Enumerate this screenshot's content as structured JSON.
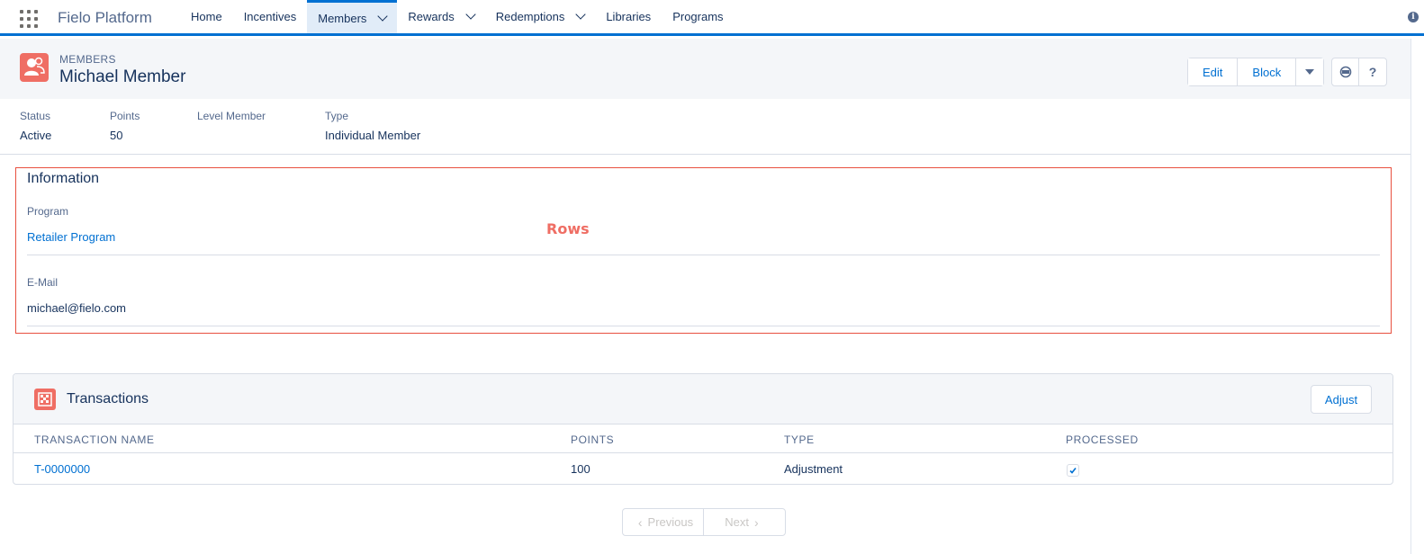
{
  "app": {
    "name": "Fielo Platform"
  },
  "nav": {
    "items": [
      {
        "label": "Home",
        "has_menu": false,
        "active": false
      },
      {
        "label": "Incentives",
        "has_menu": false,
        "active": false
      },
      {
        "label": "Members",
        "has_menu": true,
        "active": true
      },
      {
        "label": "Rewards",
        "has_menu": true,
        "active": false
      },
      {
        "label": "Redemptions",
        "has_menu": true,
        "active": false
      },
      {
        "label": "Libraries",
        "has_menu": false,
        "active": false
      },
      {
        "label": "Programs",
        "has_menu": false,
        "active": false
      }
    ]
  },
  "record": {
    "object_label": "MEMBERS",
    "title": "Michael Member",
    "actions": {
      "edit": "Edit",
      "block": "Block"
    }
  },
  "highlights": [
    {
      "label": "Status",
      "value": "Active"
    },
    {
      "label": "Points",
      "value": "50"
    },
    {
      "label": "Level Member",
      "value": ""
    },
    {
      "label": "Type",
      "value": "Individual Member"
    }
  ],
  "information": {
    "title": "Information",
    "annotation": "Rows",
    "fields": [
      {
        "label": "Program",
        "value": "Retailer Program",
        "is_link": true
      },
      {
        "label": "E-Mail",
        "value": "michael@fielo.com",
        "is_link": false
      }
    ]
  },
  "transactions": {
    "title": "Transactions",
    "adjust_label": "Adjust",
    "columns": [
      "TRANSACTION NAME",
      "POINTS",
      "TYPE",
      "PROCESSED"
    ],
    "rows": [
      {
        "name": "T-0000000",
        "points": "100",
        "type": "Adjustment",
        "processed": true
      }
    ]
  },
  "pagination": {
    "previous": "Previous",
    "next": "Next"
  },
  "colors": {
    "accent": "#0070d2",
    "brand": "#ef6e64",
    "annotation": "#e8503f"
  }
}
